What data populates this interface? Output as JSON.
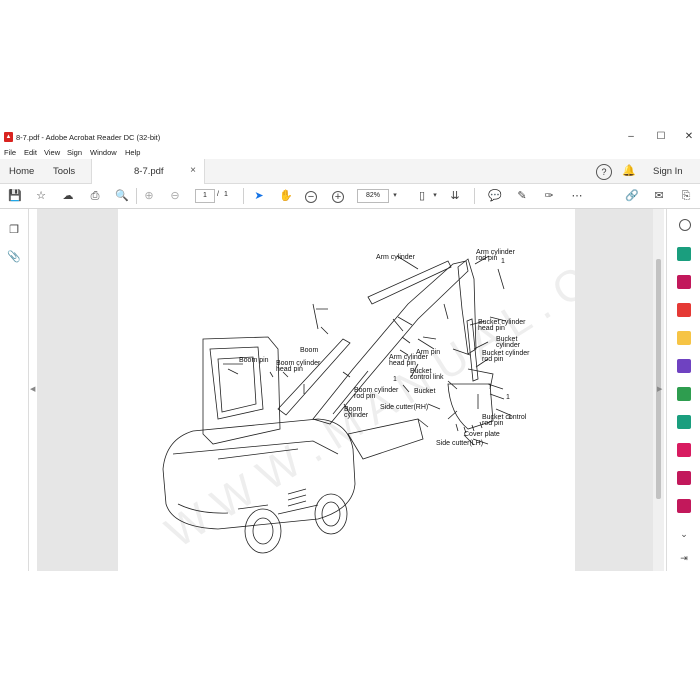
{
  "window": {
    "title": "8-7.pdf - Adobe Acrobat Reader DC (32-bit)",
    "minimize": "–",
    "maximize": "☐",
    "close": "✕"
  },
  "menu": [
    "File",
    "Edit",
    "View",
    "Sign",
    "Window",
    "Help"
  ],
  "tabs": {
    "home": "Home",
    "tools": "Tools",
    "document": "8-7.pdf",
    "sign_in": "Sign In"
  },
  "toolbar": {
    "page_current": "1",
    "page_separator": "/",
    "page_total": "1",
    "zoom": "82%"
  },
  "diagram": {
    "labels": {
      "arm_cylinder_rod_pin": [
        "Arm cylinder",
        "rod pin"
      ],
      "arm_cylinder": [
        "Arm cylinder"
      ],
      "bucket_cylinder_head_pin": [
        "Bucket cylinder",
        "head pin"
      ],
      "bucket_cylinder": [
        "Bucket",
        "cylinder"
      ],
      "bucket_cylinder_rod_pin": [
        "Bucket cylinder",
        "rod pin"
      ],
      "boom": [
        "Boom"
      ],
      "arm_pin": [
        "Arm pin"
      ],
      "arm_cylinder_head_pin": [
        "Arm cylinder",
        "head pin"
      ],
      "boom_pin": [
        "Boom pin"
      ],
      "boom_cylinder_head_pin": [
        "Boom cylinder",
        "head pin"
      ],
      "bucket_control_link": [
        "Bucket",
        "control link"
      ],
      "boom_cylinder_rod_pin": [
        "Boom cylinder",
        "rod pin"
      ],
      "bucket": [
        "Bucket"
      ],
      "boom_cylinder": [
        "Boom",
        "cylinder"
      ],
      "side_cutter_rh": [
        "Side cutter(RH)"
      ],
      "bucket_control_rod_pin": [
        "Bucket control",
        "rod pin"
      ],
      "cover_plate": [
        "Cover plate"
      ],
      "side_cutter_lh": [
        "Side cutter(LH)"
      ]
    },
    "callout_number": "1"
  },
  "colors": {
    "acrobat_red": "#d9231f",
    "select_tool_blue": "#1473e6",
    "viewer_bg": "#e6e6e6"
  }
}
